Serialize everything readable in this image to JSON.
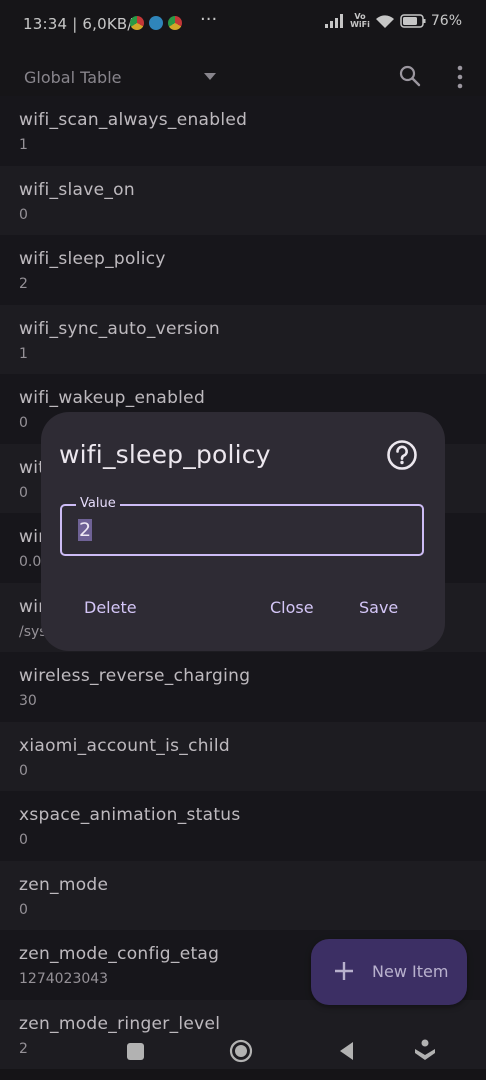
{
  "status_bar": {
    "time": "13:34 | 6,0KB/s",
    "more": "···",
    "vowifi_top": "Vo",
    "vowifi_bottom": "WiFi",
    "battery": "76%"
  },
  "app_bar": {
    "title": "Global Table",
    "icons": [
      "dropdown-caret",
      "search-icon",
      "more-vert-icon"
    ]
  },
  "list": [
    {
      "name": "wifi_scan_always_enabled",
      "value": "1"
    },
    {
      "name": "wifi_slave_on",
      "value": "0"
    },
    {
      "name": "wifi_sleep_policy",
      "value": "2"
    },
    {
      "name": "wifi_sync_auto_version",
      "value": "1"
    },
    {
      "name": "wifi_wakeup_enabled",
      "value": "0"
    },
    {
      "name": "wit",
      "value": "0"
    },
    {
      "name": "wir",
      "value": "0.0"
    },
    {
      "name": "wir",
      "value": "/sys"
    },
    {
      "name": "wireless_reverse_charging",
      "value": "30"
    },
    {
      "name": "xiaomi_account_is_child",
      "value": "0"
    },
    {
      "name": "xspace_animation_status",
      "value": "0"
    },
    {
      "name": "zen_mode",
      "value": "0"
    },
    {
      "name": "zen_mode_config_etag",
      "value": "1274023043"
    },
    {
      "name": "zen_mode_ringer_level",
      "value": "2"
    }
  ],
  "dialog": {
    "title": "wifi_sleep_policy",
    "field_label": "Value",
    "field_value": "2",
    "delete_label": "Delete",
    "close_label": "Close",
    "save_label": "Save"
  },
  "fab": {
    "label": "New Item"
  },
  "colors": {
    "accent": "#cdbcf5",
    "fab_bg": "#4a3a7a",
    "dialog_bg": "#2e2b34"
  }
}
